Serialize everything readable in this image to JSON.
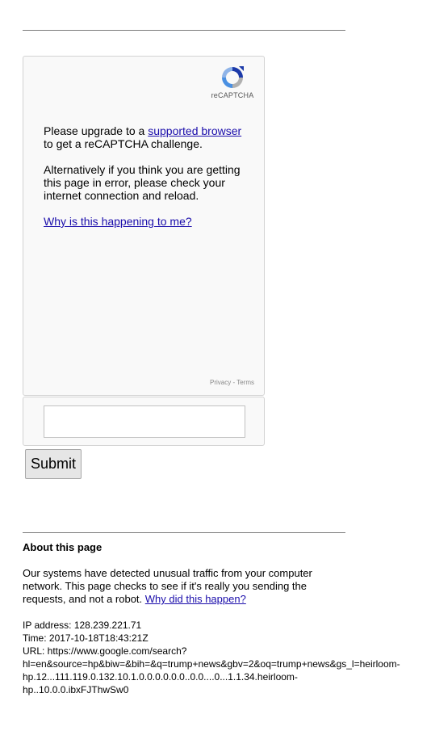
{
  "captcha": {
    "logo_label": "reCAPTCHA",
    "upgrade_prefix": "Please upgrade to a ",
    "upgrade_link": "supported browser",
    "upgrade_suffix": "to get a reCAPTCHA challenge.",
    "alternative_text": "Alternatively if you think you are getting this page in error, please check your internet connection and reload.",
    "why_link": "Why is this happening to me?",
    "privacy_label": "Privacy",
    "privacy_separator": " - ",
    "terms_label": "Terms",
    "icon": "recaptcha-logo"
  },
  "form": {
    "response_value": "",
    "submit_label": "Submit"
  },
  "about": {
    "title": "About this page",
    "body": "Our systems have detected unusual traffic from your computer network. This page checks to see if it's really you sending the requests, and not a robot. ",
    "why_link": "Why did this happen?",
    "ip_line": "IP address: 128.239.221.71",
    "time_line": "Time: 2017-10-18T18:43:21Z",
    "url_line_1": "URL: https://www.google.com/search?",
    "url_line_2": "hl=en&source=hp&biw=&bih=&q=trump+news&gbv=2&oq=trump+news&gs_l=heirloom-",
    "url_line_3": "hp.12...111.119.0.132.10.1.0.0.0.0.0.0..0.0....0...1.1.34.heirloom-",
    "url_line_4": "hp..10.0.0.ibxFJThwSw0"
  },
  "colors": {
    "link": "#1a0dab",
    "logo_blue": "#1c3aa9",
    "logo_light": "#4a90e2",
    "logo_grey": "#b0b0b0"
  }
}
